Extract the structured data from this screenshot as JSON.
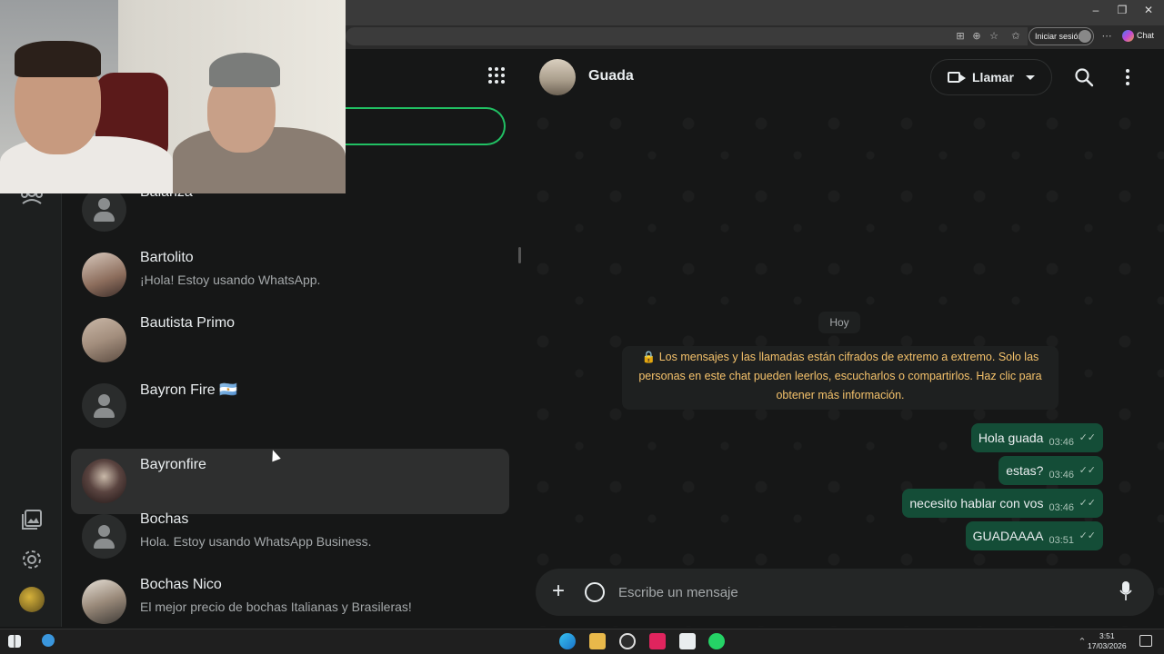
{
  "browser": {
    "signin_label": "Iniciar sesión",
    "chat_label": "Chat",
    "window_controls": [
      "minimize-icon",
      "restore-icon",
      "close-icon"
    ]
  },
  "chat_list": {
    "items": [
      {
        "name": "Balanza",
        "preview": "",
        "avatar": "placeholder"
      },
      {
        "name": "Bartolito",
        "preview": "¡Hola! Estoy usando WhatsApp.",
        "avatar": "photo"
      },
      {
        "name": "Bautista Primo",
        "preview": "",
        "avatar": "photo"
      },
      {
        "name": "Bayron Fire 🇦🇷",
        "preview": "",
        "avatar": "placeholder"
      },
      {
        "name": "Bayronfire",
        "preview": "",
        "avatar": "photo",
        "active": true
      },
      {
        "name": "Bochas",
        "preview": "Hola. Estoy usando WhatsApp Business.",
        "avatar": "placeholder"
      },
      {
        "name": "Bochas Nico",
        "preview": "El mejor precio de bochas Italianas y Brasileras!",
        "avatar": "photo"
      }
    ]
  },
  "conversation": {
    "contact_name": "Guada",
    "call_label": "Llamar",
    "date_chip": "Hoy",
    "e2e_note": "🔒 Los mensajes y las llamadas están cifrados de extremo a extremo. Solo las personas en este chat pueden leerlos, escucharlos o compartirlos. Haz clic para obtener más información.",
    "messages": [
      {
        "text": "Hola guada",
        "time": "03:46",
        "status": "✓✓"
      },
      {
        "text": "estas?",
        "time": "03:46",
        "status": "✓✓"
      },
      {
        "text": "necesito hablar con vos",
        "time": "03:46",
        "status": "✓✓"
      },
      {
        "text": "GUADAAAA",
        "time": "03:51",
        "status": "✓✓"
      }
    ],
    "composer_placeholder": "Escribe un mensaje"
  },
  "taskbar": {
    "time": "3:51",
    "date": "17/03/2026"
  },
  "colors": {
    "accent": "#21c063",
    "bubble_out": "#144d37",
    "panel_bg": "#161717",
    "note_text": "#f5c26b"
  }
}
